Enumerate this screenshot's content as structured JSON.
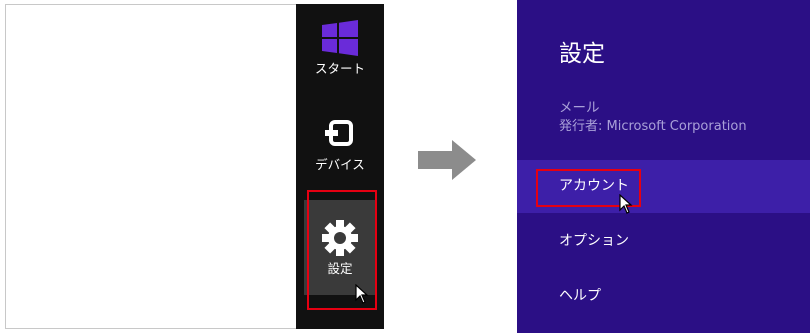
{
  "charms": {
    "start_label": "スタート",
    "devices_label": "デバイス",
    "settings_label": "設定"
  },
  "flyout": {
    "title": "設定",
    "app_name": "メール",
    "publisher": "発行者: Microsoft Corporation",
    "items": [
      {
        "label": "アカウント"
      },
      {
        "label": "オプション"
      },
      {
        "label": "ヘルプ"
      }
    ]
  },
  "colors": {
    "charms_bg": "#111111",
    "flyout_bg": "#2b0f85",
    "selected_item_bg": "#3d1fa8",
    "windows_logo": "#6a2bd9",
    "highlight_border": "#e60012",
    "arrow": "#8c8c8c"
  },
  "icons": [
    "windows-logo-icon",
    "devices-icon",
    "gear-icon",
    "right-arrow-icon",
    "mouse-pointer-icon"
  ]
}
